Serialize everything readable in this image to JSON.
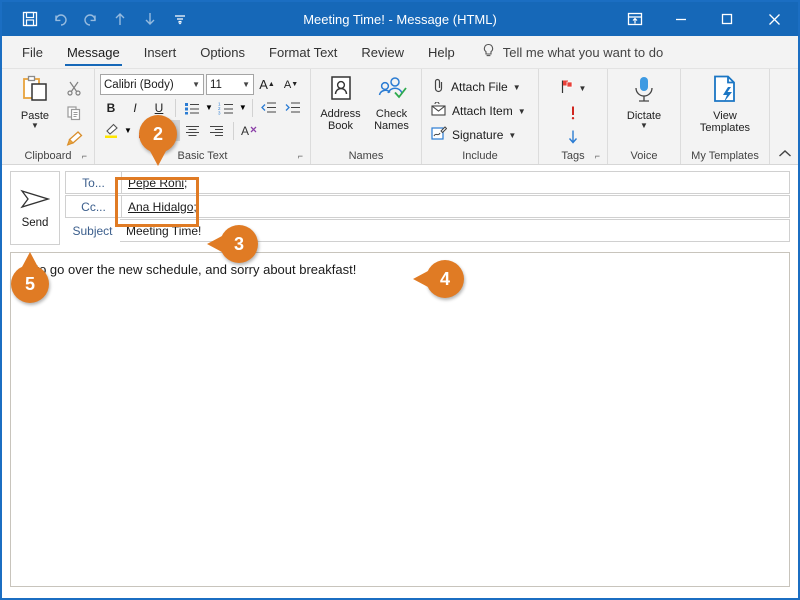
{
  "window": {
    "title": "Meeting Time! - Message (HTML)",
    "accent_color": "#1668b8",
    "annotation_color": "#e07b24",
    "quick_access": [
      {
        "name": "save-icon",
        "label": "Save"
      },
      {
        "name": "undo-icon",
        "label": "Undo"
      },
      {
        "name": "redo-icon",
        "label": "Redo"
      },
      {
        "name": "previous-item-icon",
        "label": "Previous Item"
      },
      {
        "name": "next-item-icon",
        "label": "Next Item"
      },
      {
        "name": "customize-quick-access-toolbar-icon",
        "label": "Customize Quick Access Toolbar"
      }
    ],
    "controls": [
      {
        "name": "ribbon-display-options-icon",
        "label": "Ribbon Display Options"
      },
      {
        "name": "minimize-icon",
        "label": "Minimize"
      },
      {
        "name": "maximize-icon",
        "label": "Maximize"
      },
      {
        "name": "close-icon",
        "label": "Close"
      }
    ]
  },
  "tabs": [
    {
      "label": "File",
      "active": false
    },
    {
      "label": "Message",
      "active": true
    },
    {
      "label": "Insert",
      "active": false
    },
    {
      "label": "Options",
      "active": false
    },
    {
      "label": "Format Text",
      "active": false
    },
    {
      "label": "Review",
      "active": false
    },
    {
      "label": "Help",
      "active": false
    }
  ],
  "tell_me": {
    "label": "Tell me what you want to do",
    "icon": "lightbulb-icon"
  },
  "ribbon": {
    "groups": {
      "clipboard": {
        "label": "Clipboard",
        "paste": "Paste",
        "cut": "Cut",
        "copy": "Copy",
        "format_painter": "Format Painter",
        "dialog_launcher": "Clipboard settings"
      },
      "basic_text": {
        "label": "Basic Text",
        "font_name": "Calibri (Body)",
        "font_size": "11",
        "grow_font": "A",
        "shrink_font": "A",
        "bold": "B",
        "italic": "I",
        "underline": "U",
        "bullets": "Bullets",
        "numbering": "Numbering",
        "decrease_indent": "Decrease Indent",
        "increase_indent": "Increase Indent",
        "highlight": "Text Highlight Color",
        "font_color": "A",
        "align_left": "Align Left",
        "align_center": "Center",
        "align_right": "Align Right",
        "clear_formatting": "Clear All Formatting",
        "dialog_launcher": "Font settings"
      },
      "names": {
        "label": "Names",
        "address_book": "Address Book",
        "check_names": "Check Names"
      },
      "include": {
        "label": "Include",
        "attach_file": "Attach File",
        "attach_item": "Attach Item",
        "signature": "Signature"
      },
      "tags": {
        "label": "Tags",
        "follow_up": "Follow Up",
        "high_importance": "!",
        "low_importance": "Low Importance",
        "dialog_launcher": "Tags settings"
      },
      "voice": {
        "label": "Voice",
        "dictate": "Dictate"
      },
      "my_templates": {
        "label": "My Templates",
        "view_templates": "View Templates"
      },
      "collapse": "Collapse the Ribbon"
    }
  },
  "compose": {
    "send_button": "Send",
    "to_button": "To...",
    "to_value": "Pepe Roni;",
    "cc_button": "Cc...",
    "cc_value": "Ana Hidalgo;",
    "subject_label": "Subject",
    "subject_value": "Meeting Time!",
    "body_text": "nt to go over the new schedule, and sorry about breakfast!"
  },
  "annotations": [
    {
      "number": "2",
      "target": "recipient-fields",
      "direction": "down"
    },
    {
      "number": "3",
      "target": "subject-field",
      "direction": "left"
    },
    {
      "number": "4",
      "target": "message-body",
      "direction": "left"
    },
    {
      "number": "5",
      "target": "send-button",
      "direction": "up"
    }
  ]
}
